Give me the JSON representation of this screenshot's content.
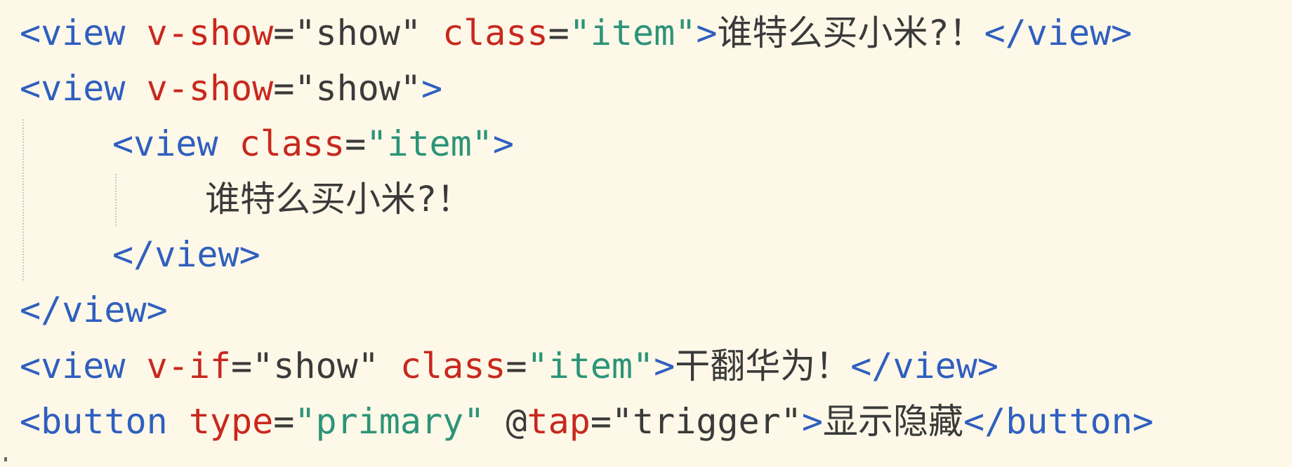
{
  "code": {
    "lines": [
      {
        "tokens": [
          {
            "kind": "tag",
            "text": "<view"
          },
          {
            "kind": "txt",
            "text": " "
          },
          {
            "kind": "attr",
            "text": "v-show"
          },
          {
            "kind": "eq",
            "text": "="
          },
          {
            "kind": "qv",
            "text": "\"show\""
          },
          {
            "kind": "txt",
            "text": " "
          },
          {
            "kind": "attr",
            "text": "class"
          },
          {
            "kind": "eq",
            "text": "="
          },
          {
            "kind": "str",
            "text": "\"item\""
          },
          {
            "kind": "tag",
            "text": ">"
          },
          {
            "kind": "txt",
            "text": "谁特么买小米?！"
          },
          {
            "kind": "tag",
            "text": "</view>"
          }
        ]
      },
      {
        "tokens": [
          {
            "kind": "tag",
            "text": "<view"
          },
          {
            "kind": "txt",
            "text": " "
          },
          {
            "kind": "attr",
            "text": "v-show"
          },
          {
            "kind": "eq",
            "text": "="
          },
          {
            "kind": "qv",
            "text": "\"show\""
          },
          {
            "kind": "tag",
            "text": ">"
          }
        ]
      },
      {
        "tokens": [
          {
            "kind": "tag",
            "text": "<view"
          },
          {
            "kind": "txt",
            "text": " "
          },
          {
            "kind": "attr",
            "text": "class"
          },
          {
            "kind": "eq",
            "text": "="
          },
          {
            "kind": "str",
            "text": "\"item\""
          },
          {
            "kind": "tag",
            "text": ">"
          }
        ]
      },
      {
        "tokens": [
          {
            "kind": "txt",
            "text": "谁特么买小米?！"
          }
        ]
      },
      {
        "tokens": [
          {
            "kind": "tag",
            "text": "</view>"
          }
        ]
      },
      {
        "tokens": [
          {
            "kind": "tag",
            "text": "</view>"
          }
        ]
      },
      {
        "tokens": [
          {
            "kind": "tag",
            "text": "<view"
          },
          {
            "kind": "txt",
            "text": " "
          },
          {
            "kind": "attr",
            "text": "v-if"
          },
          {
            "kind": "eq",
            "text": "="
          },
          {
            "kind": "qv",
            "text": "\"show\""
          },
          {
            "kind": "txt",
            "text": " "
          },
          {
            "kind": "attr",
            "text": "class"
          },
          {
            "kind": "eq",
            "text": "="
          },
          {
            "kind": "str",
            "text": "\"item\""
          },
          {
            "kind": "tag",
            "text": ">"
          },
          {
            "kind": "txt",
            "text": "干翻华为！"
          },
          {
            "kind": "tag",
            "text": "</view>"
          }
        ]
      },
      {
        "tokens": [
          {
            "kind": "tag",
            "text": "<button"
          },
          {
            "kind": "txt",
            "text": " "
          },
          {
            "kind": "attr",
            "text": "type"
          },
          {
            "kind": "eq",
            "text": "="
          },
          {
            "kind": "str",
            "text": "\"primary\""
          },
          {
            "kind": "txt",
            "text": " "
          },
          {
            "kind": "at",
            "text": "@"
          },
          {
            "kind": "attr",
            "text": "tap"
          },
          {
            "kind": "eq",
            "text": "="
          },
          {
            "kind": "qv",
            "text": "\"trigger\""
          },
          {
            "kind": "tag",
            "text": ">"
          },
          {
            "kind": "txt",
            "text": "显示隐藏"
          },
          {
            "kind": "tag",
            "text": "</button>"
          }
        ]
      }
    ]
  },
  "colors": {
    "background": "#fdf8e8",
    "tag": "#2f5fbf",
    "attribute": "#c8281e",
    "string": "#2c9478",
    "text": "#3a3a3a"
  }
}
